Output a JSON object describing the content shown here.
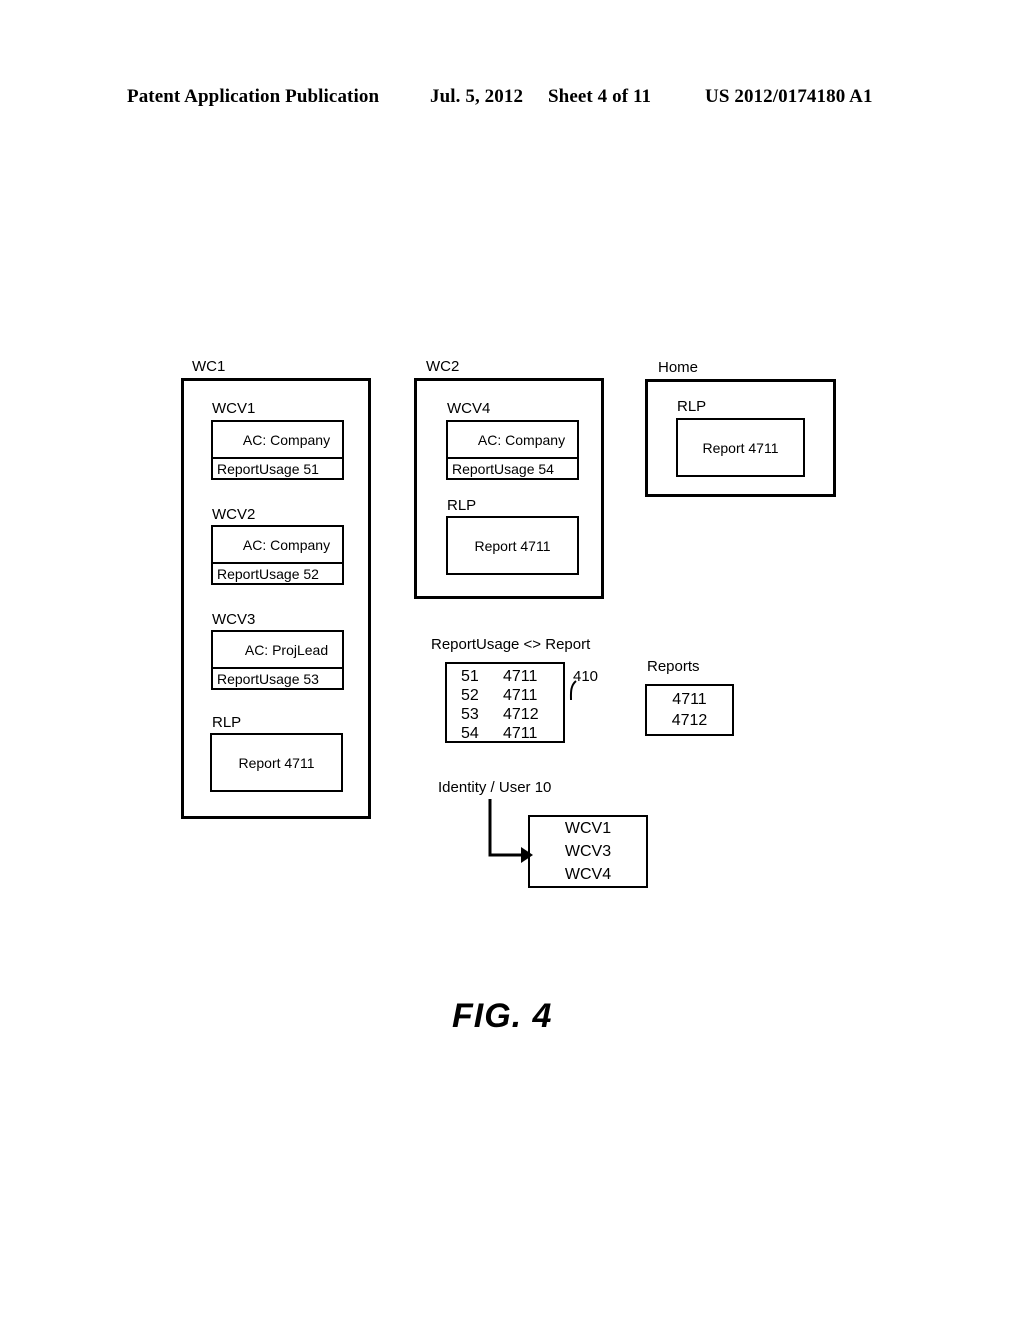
{
  "header": {
    "publication": "Patent Application Publication",
    "date": "Jul. 5, 2012",
    "sheet": "Sheet 4 of 11",
    "patent_number": "US 2012/0174180 A1"
  },
  "figure": {
    "label": "FIG.  4",
    "reference_numeral": "410"
  },
  "containers": {
    "wc1": {
      "label": "WC1",
      "views": [
        {
          "label": "WCV1",
          "ac": "AC: Company",
          "usage": "ReportUsage 51"
        },
        {
          "label": "WCV2",
          "ac": "AC: Company",
          "usage": "ReportUsage 52"
        },
        {
          "label": "WCV3",
          "ac": "AC: ProjLead",
          "usage": "ReportUsage 53"
        }
      ],
      "rlp": {
        "label": "RLP",
        "report": "Report 4711"
      }
    },
    "wc2": {
      "label": "WC2",
      "views": [
        {
          "label": "WCV4",
          "ac": "AC: Company",
          "usage": "ReportUsage 54"
        }
      ],
      "rlp": {
        "label": "RLP",
        "report": "Report 4711"
      }
    },
    "home": {
      "label": "Home",
      "rlp": {
        "label": "RLP",
        "report": "Report 4711"
      }
    }
  },
  "mapping_table": {
    "label": "ReportUsage <> Report",
    "rows": [
      {
        "usage": "51",
        "report": "4711"
      },
      {
        "usage": "52",
        "report": "4711"
      },
      {
        "usage": "53",
        "report": "4712"
      },
      {
        "usage": "54",
        "report": "4711"
      }
    ]
  },
  "reports": {
    "label": "Reports",
    "items": [
      "4711",
      "4712"
    ]
  },
  "identity": {
    "label": "Identity / User 10",
    "assigned_views": [
      "WCV1",
      "WCV3",
      "WCV4"
    ]
  }
}
